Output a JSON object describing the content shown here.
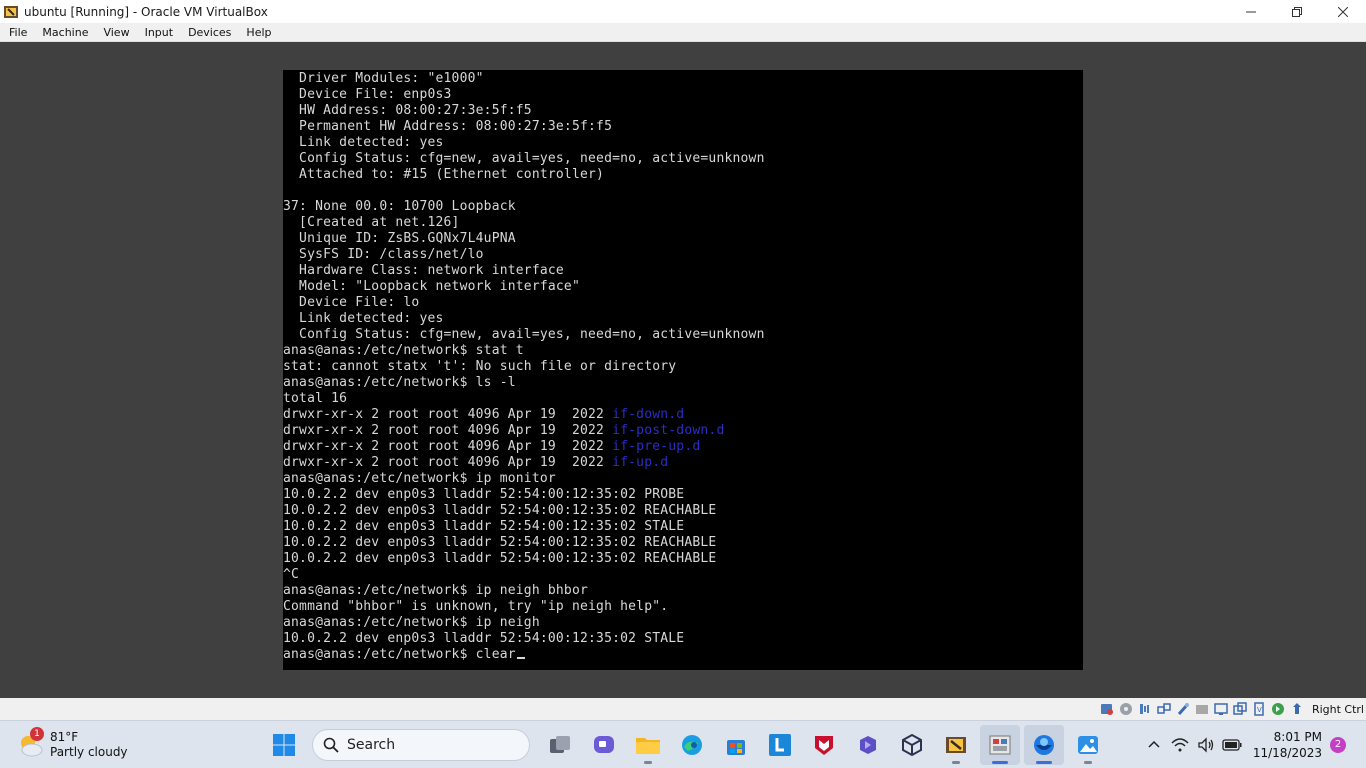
{
  "window": {
    "title": "ubuntu [Running] - Oracle VM VirtualBox",
    "minimize_icon": "minimize-icon",
    "maximize_icon": "restore-icon",
    "close_icon": "close-icon"
  },
  "menubar": {
    "items": [
      "File",
      "Machine",
      "View",
      "Input",
      "Devices",
      "Help"
    ]
  },
  "terminal": {
    "lines": [
      "  Driver Modules: \"e1000\"",
      "  Device File: enp0s3",
      "  HW Address: 08:00:27:3e:5f:f5",
      "  Permanent HW Address: 08:00:27:3e:5f:f5",
      "  Link detected: yes",
      "  Config Status: cfg=new, avail=yes, need=no, active=unknown",
      "  Attached to: #15 (Ethernet controller)",
      "",
      "37: None 00.0: 10700 Loopback",
      "  [Created at net.126]",
      "  Unique ID: ZsBS.GQNx7L4uPNA",
      "  SysFS ID: /class/net/lo",
      "  Hardware Class: network interface",
      "  Model: \"Loopback network interface\"",
      "  Device File: lo",
      "  Link detected: yes",
      "  Config Status: cfg=new, avail=yes, need=no, active=unknown",
      "anas@anas:/etc/network$ stat t",
      "stat: cannot statx 't': No such file or directory",
      "anas@anas:/etc/network$ ls -l",
      "total 16",
      "drwxr-xr-x 2 root root 4096 Apr 19  2022 ",
      "drwxr-xr-x 2 root root 4096 Apr 19  2022 ",
      "drwxr-xr-x 2 root root 4096 Apr 19  2022 ",
      "drwxr-xr-x 2 root root 4096 Apr 19  2022 ",
      "anas@anas:/etc/network$ ip monitor",
      "10.0.2.2 dev enp0s3 lladdr 52:54:00:12:35:02 PROBE",
      "10.0.2.2 dev enp0s3 lladdr 52:54:00:12:35:02 REACHABLE",
      "10.0.2.2 dev enp0s3 lladdr 52:54:00:12:35:02 STALE",
      "10.0.2.2 dev enp0s3 lladdr 52:54:00:12:35:02 REACHABLE",
      "10.0.2.2 dev enp0s3 lladdr 52:54:00:12:35:02 REACHABLE",
      "^C",
      "anas@anas:/etc/network$ ip neigh bhbor",
      "Command \"bhbor\" is unknown, try \"ip neigh help\".",
      "anas@anas:/etc/network$ ip neigh",
      "10.0.2.2 dev enp0s3 lladdr 52:54:00:12:35:02 STALE",
      "anas@anas:/etc/network$ clear"
    ],
    "dir_entries": {
      "21": "if-down.d",
      "22": "if-post-down.d",
      "23": "if-pre-up.d",
      "24": "if-up.d"
    },
    "dir_color": "#2c2cc8",
    "text_color": "#d8d8d8"
  },
  "vbox_status": {
    "icons": [
      "storage-icon",
      "optical-drive-icon",
      "audio-icon",
      "network-icon",
      "usb-icon",
      "shared-folder-icon",
      "display-icon",
      "video-capture-icon",
      "virtualization-icon",
      "mouse-integration-icon",
      "keyboard-icon"
    ],
    "host_key": "Right Ctrl"
  },
  "taskbar": {
    "weather": {
      "temp": "81°F",
      "desc": "Partly cloudy",
      "badge": "1"
    },
    "search_label": "Search",
    "apps": [
      "start-icon",
      "task-view-icon",
      "chat-icon",
      "file-explorer-icon",
      "edge-icon",
      "store-icon",
      "l-app-icon",
      "mcafee-icon",
      "vs-code-icon",
      "cube-app-icon",
      "mingw-icon",
      "virtualbox-icon",
      "browser-icon",
      "photos-icon"
    ],
    "clock": {
      "time": "8:01 PM",
      "date": "11/18/2023"
    },
    "notifications": "2"
  },
  "colors": {
    "taskbar_bg": "#dde4ee",
    "terminal_bg": "#000000",
    "vm_bg": "#404040",
    "accent": "#3a6fd8"
  }
}
